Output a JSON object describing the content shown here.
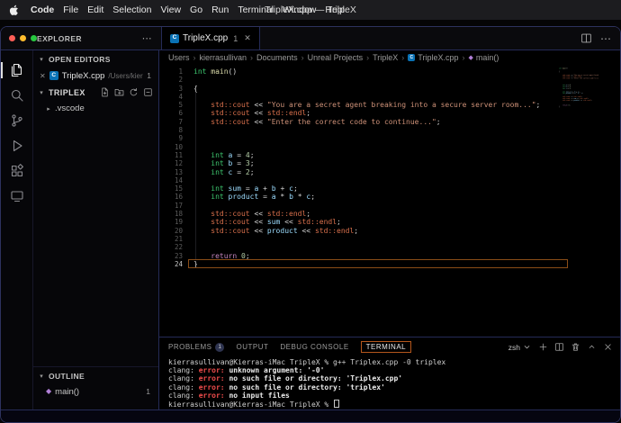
{
  "menubar": {
    "items": [
      "Code",
      "File",
      "Edit",
      "Selection",
      "View",
      "Go",
      "Run",
      "Terminal",
      "Window",
      "Help"
    ],
    "window_title": "TripleX.cpp — TripleX"
  },
  "icons": {
    "close": "✕",
    "more": "⋯",
    "chev_open": "▾",
    "chev_closed": "▸",
    "crumb_sep": "›",
    "method": "◆",
    "cpp_letter": "C"
  },
  "activity_bar": {
    "items": [
      {
        "name": "activity-explorer",
        "icon": "explorer",
        "active": true
      },
      {
        "name": "activity-search",
        "icon": "search"
      },
      {
        "name": "activity-source-control",
        "icon": "scm"
      },
      {
        "name": "activity-run-debug",
        "icon": "debug"
      },
      {
        "name": "activity-extensions",
        "icon": "extensions"
      },
      {
        "name": "activity-remote-explorer",
        "icon": "remote"
      }
    ]
  },
  "sidebar": {
    "explorer_title": "EXPLORER",
    "open_editors_title": "OPEN EDITORS",
    "open_editor_item": {
      "file": "TripleX.cpp",
      "path": "/Users/kierras...",
      "badge": "1"
    },
    "project_title": "TRIPLEX",
    "folder_item": ".vscode",
    "outline_title": "OUTLINE",
    "outline_item": {
      "label": "main()",
      "badge": "1"
    }
  },
  "editor": {
    "tab": {
      "label": "TripleX.cpp",
      "badge": "1"
    },
    "breadcrumb": [
      {
        "label": "Users"
      },
      {
        "label": "kierrasullivan"
      },
      {
        "label": "Documents"
      },
      {
        "label": "Unreal Projects"
      },
      {
        "label": "TripleX"
      },
      {
        "label": "TripleX.cpp",
        "icon": "cpp"
      },
      {
        "label": "main()",
        "icon": "method"
      }
    ],
    "lines": [
      {
        "n": 1,
        "t": [
          [
            "int",
            "kw"
          ],
          [
            " ",
            "pl"
          ],
          [
            "main",
            "fn"
          ],
          [
            "()",
            "pl"
          ]
        ]
      },
      {
        "n": 2,
        "t": []
      },
      {
        "n": 3,
        "t": [
          [
            "{",
            "pl"
          ]
        ]
      },
      {
        "n": 4,
        "t": []
      },
      {
        "n": 5,
        "t": [
          [
            "    ",
            "pl"
          ],
          [
            "std::cout",
            "std"
          ],
          [
            " ",
            "pl"
          ],
          [
            "<<",
            "op"
          ],
          [
            " ",
            "pl"
          ],
          [
            "\"You are a secret agent breaking into a secure server room...\"",
            "str"
          ],
          [
            ";",
            "pl"
          ]
        ]
      },
      {
        "n": 6,
        "t": [
          [
            "    ",
            "pl"
          ],
          [
            "std::cout",
            "std"
          ],
          [
            " ",
            "pl"
          ],
          [
            "<<",
            "op"
          ],
          [
            " ",
            "pl"
          ],
          [
            "std::endl",
            "std"
          ],
          [
            ";",
            "pl"
          ]
        ]
      },
      {
        "n": 7,
        "t": [
          [
            "    ",
            "pl"
          ],
          [
            "std::cout",
            "std"
          ],
          [
            " ",
            "pl"
          ],
          [
            "<<",
            "op"
          ],
          [
            " ",
            "pl"
          ],
          [
            "\"Enter the correct code to continue...\"",
            "str"
          ],
          [
            ";",
            "pl"
          ]
        ]
      },
      {
        "n": 8,
        "t": []
      },
      {
        "n": 9,
        "t": []
      },
      {
        "n": 10,
        "t": []
      },
      {
        "n": 11,
        "t": [
          [
            "    ",
            "pl"
          ],
          [
            "int",
            "kw"
          ],
          [
            " ",
            "pl"
          ],
          [
            "a",
            "var"
          ],
          [
            " ",
            "pl"
          ],
          [
            "=",
            "op"
          ],
          [
            " ",
            "pl"
          ],
          [
            "4",
            "num"
          ],
          [
            ";",
            "pl"
          ]
        ]
      },
      {
        "n": 12,
        "t": [
          [
            "    ",
            "pl"
          ],
          [
            "int",
            "kw"
          ],
          [
            " ",
            "pl"
          ],
          [
            "b",
            "var"
          ],
          [
            " ",
            "pl"
          ],
          [
            "=",
            "op"
          ],
          [
            " ",
            "pl"
          ],
          [
            "3",
            "num"
          ],
          [
            ";",
            "pl"
          ]
        ]
      },
      {
        "n": 13,
        "t": [
          [
            "    ",
            "pl"
          ],
          [
            "int",
            "kw"
          ],
          [
            " ",
            "pl"
          ],
          [
            "c",
            "var"
          ],
          [
            " ",
            "pl"
          ],
          [
            "=",
            "op"
          ],
          [
            " ",
            "pl"
          ],
          [
            "2",
            "num"
          ],
          [
            ";",
            "pl"
          ]
        ]
      },
      {
        "n": 14,
        "t": []
      },
      {
        "n": 15,
        "t": [
          [
            "    ",
            "pl"
          ],
          [
            "int",
            "kw"
          ],
          [
            " ",
            "pl"
          ],
          [
            "sum",
            "var"
          ],
          [
            " ",
            "pl"
          ],
          [
            "=",
            "op"
          ],
          [
            " ",
            "pl"
          ],
          [
            "a",
            "var"
          ],
          [
            " ",
            "pl"
          ],
          [
            "+",
            "op"
          ],
          [
            " ",
            "pl"
          ],
          [
            "b",
            "var"
          ],
          [
            " ",
            "pl"
          ],
          [
            "+",
            "op"
          ],
          [
            " ",
            "pl"
          ],
          [
            "c",
            "var"
          ],
          [
            ";",
            "pl"
          ]
        ]
      },
      {
        "n": 16,
        "t": [
          [
            "    ",
            "pl"
          ],
          [
            "int",
            "kw"
          ],
          [
            " ",
            "pl"
          ],
          [
            "product",
            "var"
          ],
          [
            " ",
            "pl"
          ],
          [
            "=",
            "op"
          ],
          [
            " ",
            "pl"
          ],
          [
            "a",
            "var"
          ],
          [
            " ",
            "pl"
          ],
          [
            "*",
            "op"
          ],
          [
            " ",
            "pl"
          ],
          [
            "b",
            "var"
          ],
          [
            " ",
            "pl"
          ],
          [
            "*",
            "op"
          ],
          [
            " ",
            "pl"
          ],
          [
            "c",
            "var"
          ],
          [
            ";",
            "pl"
          ]
        ]
      },
      {
        "n": 17,
        "t": []
      },
      {
        "n": 18,
        "t": [
          [
            "    ",
            "pl"
          ],
          [
            "std::cout",
            "std"
          ],
          [
            " ",
            "pl"
          ],
          [
            "<<",
            "op"
          ],
          [
            " ",
            "pl"
          ],
          [
            "std::endl",
            "std"
          ],
          [
            ";",
            "pl"
          ]
        ]
      },
      {
        "n": 19,
        "t": [
          [
            "    ",
            "pl"
          ],
          [
            "std::cout",
            "std"
          ],
          [
            " ",
            "pl"
          ],
          [
            "<<",
            "op"
          ],
          [
            " ",
            "pl"
          ],
          [
            "sum",
            "var"
          ],
          [
            " ",
            "pl"
          ],
          [
            "<<",
            "op"
          ],
          [
            " ",
            "pl"
          ],
          [
            "std::endl",
            "std"
          ],
          [
            ";",
            "pl"
          ]
        ]
      },
      {
        "n": 20,
        "t": [
          [
            "    ",
            "pl"
          ],
          [
            "std::cout",
            "std"
          ],
          [
            " ",
            "pl"
          ],
          [
            "<<",
            "op"
          ],
          [
            " ",
            "pl"
          ],
          [
            "product",
            "var"
          ],
          [
            " ",
            "pl"
          ],
          [
            "<<",
            "op"
          ],
          [
            " ",
            "pl"
          ],
          [
            "std::endl",
            "std"
          ],
          [
            ";",
            "pl"
          ]
        ]
      },
      {
        "n": 21,
        "t": []
      },
      {
        "n": 22,
        "t": []
      },
      {
        "n": 23,
        "t": [
          [
            "    ",
            "pl"
          ],
          [
            "return",
            "ctrl"
          ],
          [
            " ",
            "pl"
          ],
          [
            "0",
            "num"
          ],
          [
            ";",
            "pl"
          ]
        ]
      },
      {
        "n": 24,
        "t": [
          [
            "}",
            "pl"
          ]
        ],
        "current": true
      }
    ]
  },
  "panel": {
    "tabs": [
      {
        "label": "PROBLEMS",
        "badge": "1"
      },
      {
        "label": "OUTPUT"
      },
      {
        "label": "DEBUG CONSOLE"
      },
      {
        "label": "TERMINAL",
        "active": true
      }
    ],
    "shell": "zsh",
    "terminal_lines": [
      {
        "t": [
          [
            "kierrasullivan@Kierras-iMac TripleX % g++ Triplex.cpp -0 triplex",
            "t"
          ]
        ]
      },
      {
        "t": [
          [
            "clang: ",
            "t"
          ],
          [
            "error: ",
            "err"
          ],
          [
            "unknown argument: '-0'",
            "tb"
          ]
        ]
      },
      {
        "t": [
          [
            "clang: ",
            "t"
          ],
          [
            "error: ",
            "err"
          ],
          [
            "no such file or directory: 'Triplex.cpp'",
            "tb"
          ]
        ]
      },
      {
        "t": [
          [
            "clang: ",
            "t"
          ],
          [
            "error: ",
            "err"
          ],
          [
            "no such file or directory: 'triplex'",
            "tb"
          ]
        ]
      },
      {
        "t": [
          [
            "clang: ",
            "t"
          ],
          [
            "error: ",
            "err"
          ],
          [
            "no input files",
            "tb"
          ]
        ]
      },
      {
        "t": [
          [
            "kierrasullivan@Kierras-iMac TripleX % ",
            "t"
          ]
        ],
        "cursor": true
      }
    ]
  }
}
